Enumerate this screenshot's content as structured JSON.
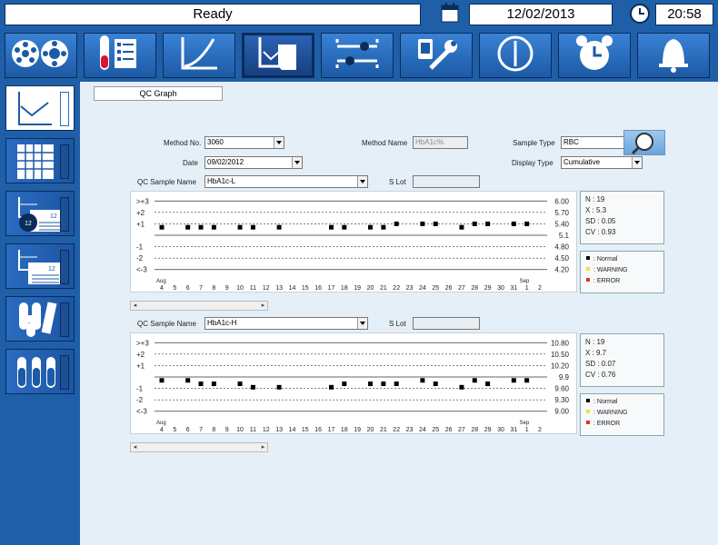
{
  "status": {
    "text": "Ready",
    "date": "12/02/2013",
    "time": "20:58"
  },
  "toolbar_icons": [
    "carousel-icon",
    "reagent-rack-icon",
    "calibration-curve-icon",
    "qc-chart-icon",
    "settings-sliders-icon",
    "maintenance-icon",
    "power-icon",
    "timer-alarm-icon",
    "bell-icon"
  ],
  "sidebar_icons": [
    "qc-graph-icon",
    "qc-grid-icon",
    "qc-monthly-icon",
    "qc-report-icon",
    "calibration-tubes-icon",
    "sample-tubes-icon"
  ],
  "page": {
    "title": "QC Graph"
  },
  "form": {
    "method_no_label": "Method No.",
    "method_no": "3060",
    "method_name_label": "Method Name",
    "method_name": "HbA1c%",
    "sample_type_label": "Sample Type",
    "sample_type": "RBC",
    "date_label": "Date",
    "date": "09/02/2012",
    "display_type_label": "Display Type",
    "display_type": "Cumulative"
  },
  "axis": {
    "y_labels": [
      ">+3",
      "+2",
      "+1",
      "",
      "-1",
      "-2",
      "<-3"
    ],
    "x_labels": [
      "4",
      "5",
      "6",
      "7",
      "8",
      "9",
      "10",
      "11",
      "12",
      "13",
      "14",
      "15",
      "16",
      "17",
      "18",
      "19",
      "20",
      "21",
      "22",
      "23",
      "24",
      "25",
      "26",
      "27",
      "28",
      "29",
      "30",
      "31",
      "1",
      "2"
    ],
    "month_start": "Aug",
    "month_end": "Sep"
  },
  "panels": [
    {
      "sample_label": "QC Sample Name",
      "sample": "HbA1c-L",
      "lot_label": "S Lot",
      "lot": "",
      "right_values": [
        "6.00",
        "5.70",
        "5.40",
        "5.1",
        "4.80",
        "4.50",
        "4.20"
      ],
      "stats": {
        "n": "N  :  19",
        "x": "X  :  5.3",
        "sd": "SD :  0.05",
        "cv": "CV :  0.93"
      },
      "legend": {
        "normal": ": Normal",
        "warning": ": WARNING",
        "error": ": ERROR"
      },
      "chart_data": {
        "type": "scatter",
        "x": [
          "4",
          "6",
          "7",
          "8",
          "10",
          "11",
          "13",
          "17",
          "18",
          "20",
          "21",
          "22",
          "24",
          "25",
          "27",
          "28",
          "29",
          "31",
          "1"
        ],
        "y": [
          0.7,
          0.7,
          0.7,
          0.7,
          0.7,
          0.7,
          0.7,
          0.7,
          0.7,
          0.7,
          0.7,
          1.0,
          1.0,
          1.0,
          0.7,
          1.0,
          1.0,
          1.0,
          1.0
        ],
        "ylim": [
          -3.5,
          3.5
        ]
      }
    },
    {
      "sample_label": "QC Sample Name",
      "sample": "HbA1c-H",
      "lot_label": "S Lot",
      "lot": "",
      "right_values": [
        "10.80",
        "10.50",
        "10.20",
        "9.9",
        "9.60",
        "9.30",
        "9.00"
      ],
      "stats": {
        "n": "N  :  19",
        "x": "X  :  9.7",
        "sd": "SD :  0.07",
        "cv": "CV :  0.76"
      },
      "legend": {
        "normal": ": Normal",
        "warning": ": WARNING",
        "error": ": ERROR"
      },
      "chart_data": {
        "type": "scatter",
        "x": [
          "4",
          "6",
          "7",
          "8",
          "10",
          "11",
          "13",
          "17",
          "18",
          "20",
          "21",
          "22",
          "24",
          "25",
          "27",
          "28",
          "29",
          "31",
          "1"
        ],
        "y": [
          -0.3,
          -0.3,
          -0.6,
          -0.6,
          -0.6,
          -0.9,
          -0.9,
          -0.9,
          -0.6,
          -0.6,
          -0.6,
          -0.6,
          -0.3,
          -0.6,
          -0.9,
          -0.3,
          -0.6,
          -0.3,
          -0.3
        ],
        "ylim": [
          -3.5,
          3.5
        ]
      }
    }
  ],
  "colors": {
    "brand": "#1f5fa8",
    "normal": "#000000",
    "warning": "#f0e040",
    "error": "#e03030"
  }
}
